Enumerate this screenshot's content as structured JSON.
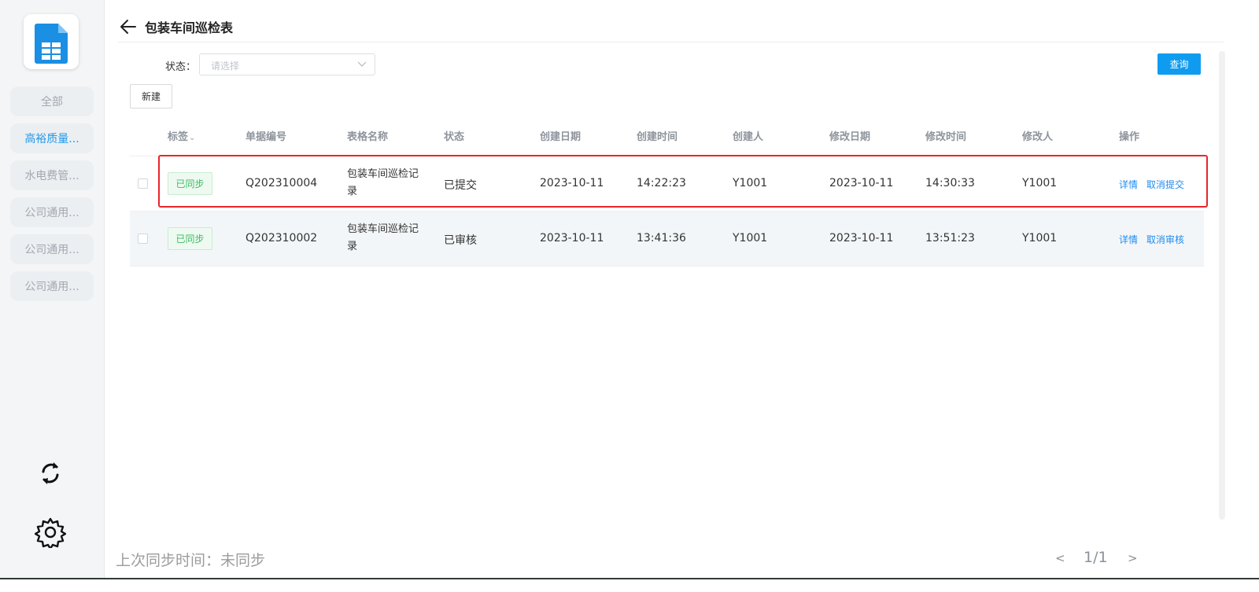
{
  "sidebar": {
    "items": [
      {
        "label": "全部",
        "active": false
      },
      {
        "label": "高裕质量...",
        "active": true
      },
      {
        "label": "水电费管...",
        "active": false
      },
      {
        "label": "公司通用...",
        "active": false
      },
      {
        "label": "公司通用...",
        "active": false
      },
      {
        "label": "公司通用...",
        "active": false
      }
    ]
  },
  "header": {
    "title": "包装车间巡检表"
  },
  "filter": {
    "status_label": "状态：",
    "status_placeholder": "请选择",
    "query_label": "查询",
    "new_label": "新建"
  },
  "table": {
    "columns": [
      "标签",
      "单据编号",
      "表格名称",
      "状态",
      "创建日期",
      "创建时间",
      "创建人",
      "修改日期",
      "修改时间",
      "修改人",
      "操作"
    ],
    "rows": [
      {
        "tag": "已同步",
        "doc_no": "Q202310004",
        "form_name": "包装车间巡检记录",
        "status": "已提交",
        "created_date": "2023-10-11",
        "created_time": "14:22:23",
        "creator": "Y1001",
        "modified_date": "2023-10-11",
        "modified_time": "14:30:33",
        "modifier": "Y1001",
        "action_detail": "详情",
        "action_other": "取消提交"
      },
      {
        "tag": "已同步",
        "doc_no": "Q202310002",
        "form_name": "包装车间巡检记录",
        "status": "已审核",
        "created_date": "2023-10-11",
        "created_time": "13:41:36",
        "creator": "Y1001",
        "modified_date": "2023-10-11",
        "modified_time": "13:51:23",
        "modifier": "Y1001",
        "action_detail": "详情",
        "action_other": "取消审核"
      }
    ]
  },
  "footer": {
    "sync_status": "上次同步时间：未同步",
    "page_indicator": "1/1",
    "prev": "<",
    "next": ">"
  },
  "colors": {
    "accent": "#0f9cf0",
    "link": "#1f8cf0",
    "sync_tag": "#3dbb63",
    "highlight": "#e8262a"
  }
}
